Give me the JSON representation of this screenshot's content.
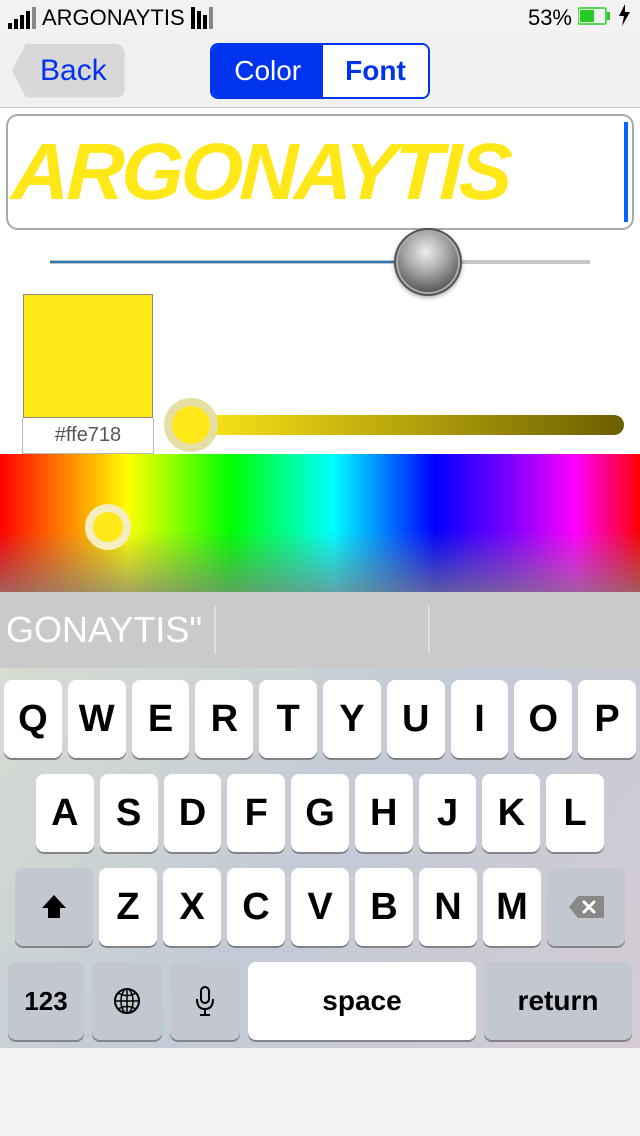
{
  "status": {
    "carrier": "ARGONAYTIS",
    "battery_pct": "53%"
  },
  "nav": {
    "back": "Back",
    "seg_color": "Color",
    "seg_font": "Font",
    "active_segment": "Color"
  },
  "editor": {
    "text": "ARGONAYTIS",
    "size_slider_value": 0.7,
    "selected_color_hex": "#ffe718",
    "shade_slider_value": 0.0,
    "spectrum_position": 0.15
  },
  "suggestions": {
    "s1": "GONAYTIS\"",
    "s2": "",
    "s3": ""
  },
  "keyboard": {
    "row1": [
      "Q",
      "W",
      "E",
      "R",
      "T",
      "Y",
      "U",
      "I",
      "O",
      "P"
    ],
    "row2": [
      "A",
      "S",
      "D",
      "F",
      "G",
      "H",
      "J",
      "K",
      "L"
    ],
    "row3": [
      "Z",
      "X",
      "C",
      "V",
      "B",
      "N",
      "M"
    ],
    "k123": "123",
    "space": "space",
    "return": "return"
  }
}
